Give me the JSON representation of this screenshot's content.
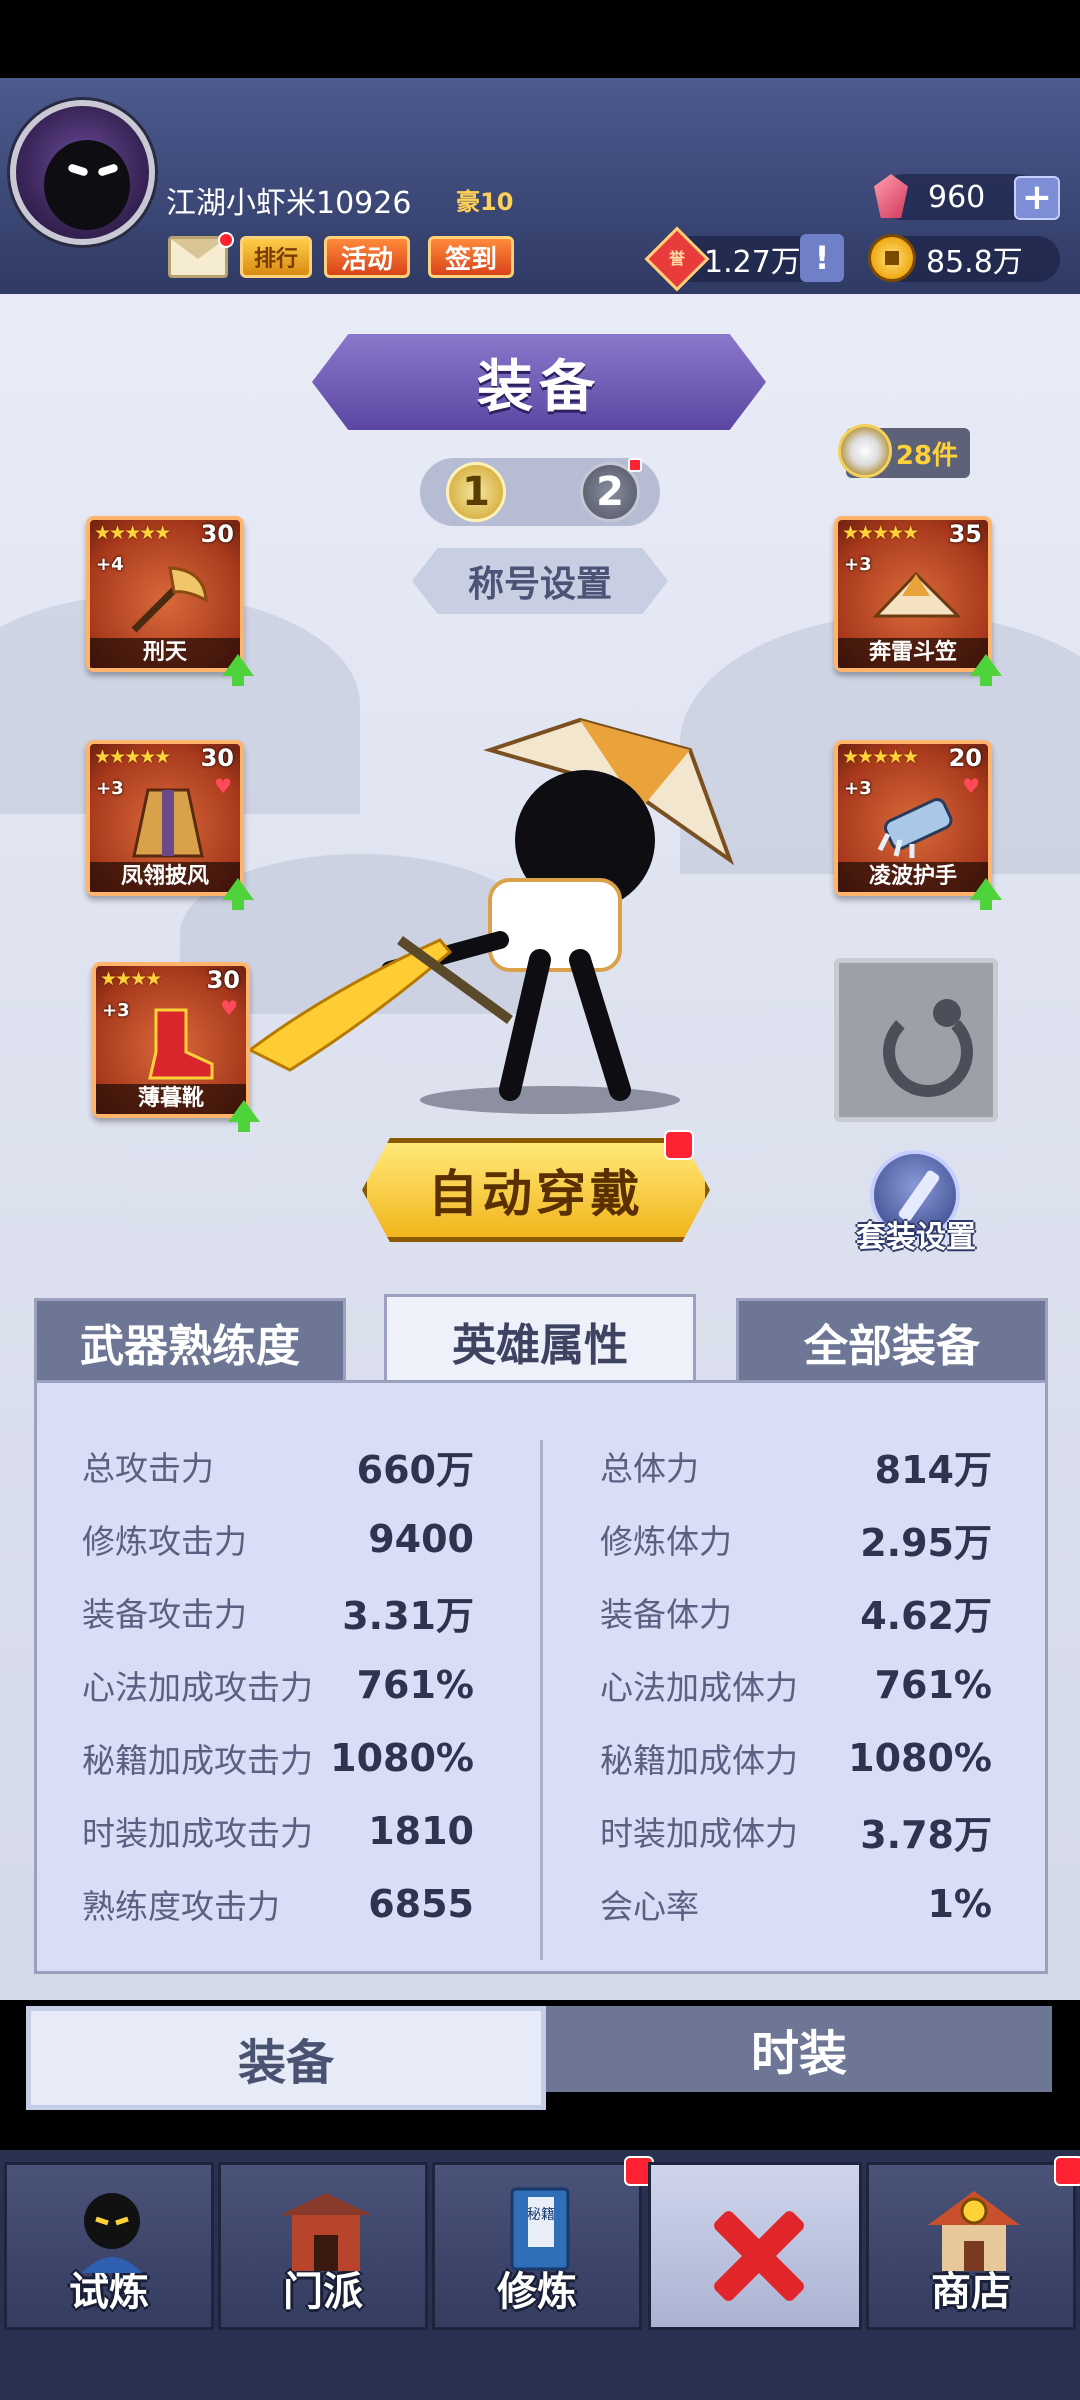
{
  "header": {
    "player_name": "江湖小虾米10926",
    "vip_label": "豪10",
    "buttons": {
      "ranking": "排行",
      "activity": "活动",
      "sign_in": "签到"
    },
    "resources": {
      "gems": "960",
      "honor": "1.27万",
      "coins": "85.8万"
    },
    "honor_icon_text": "誉"
  },
  "page": {
    "title": "装备",
    "presets": [
      "1",
      "2"
    ],
    "title_settings_button": "称号设置",
    "pieces_count": "28件",
    "auto_equip_button": "自动穿戴",
    "set_settings_label": "套装设置"
  },
  "equipment": {
    "weapon": {
      "name": "刑天",
      "stars": "★★★★★",
      "level": "30",
      "plus": "+4"
    },
    "hat": {
      "name": "奔雷斗笠",
      "stars": "★★★★★",
      "level": "35",
      "plus": "+3"
    },
    "cape": {
      "name": "凤翎披风",
      "stars": "★★★★★",
      "level": "30",
      "plus": "+3"
    },
    "gauntlet": {
      "name": "凌波护手",
      "stars": "★★★★★",
      "level": "20",
      "plus": "+3"
    },
    "boots": {
      "name": "薄暮靴",
      "stars": "★★★★",
      "level": "30",
      "plus": "+3"
    }
  },
  "tabs": {
    "mastery": "武器熟练度",
    "attributes": "英雄属性",
    "all_equipment": "全部装备"
  },
  "stats": {
    "left": [
      {
        "label": "总攻击力",
        "value": "660万"
      },
      {
        "label": "修炼攻击力",
        "value": "9400"
      },
      {
        "label": "装备攻击力",
        "value": "3.31万"
      },
      {
        "label": "心法加成攻击力",
        "value": "761%"
      },
      {
        "label": "秘籍加成攻击力",
        "value": "1080%"
      },
      {
        "label": "时装加成攻击力",
        "value": "1810"
      },
      {
        "label": "熟练度攻击力",
        "value": "6855"
      }
    ],
    "right": [
      {
        "label": "总体力",
        "value": "814万"
      },
      {
        "label": "修炼体力",
        "value": "2.95万"
      },
      {
        "label": "装备体力",
        "value": "4.62万"
      },
      {
        "label": "心法加成体力",
        "value": "761%"
      },
      {
        "label": "秘籍加成体力",
        "value": "1080%"
      },
      {
        "label": "时装加成体力",
        "value": "3.78万"
      },
      {
        "label": "会心率",
        "value": "1%"
      }
    ]
  },
  "sub_tabs": {
    "equipment": "装备",
    "fashion": "时装"
  },
  "nav": {
    "trial": "试炼",
    "sect": "门派",
    "cultivate": "修炼",
    "shop": "商店",
    "cultivate_book_text": "秘籍"
  },
  "colors": {
    "header_bg": "#3b4775",
    "accent_purple": "#5b47a2",
    "button_gold": "#f2b51c",
    "notification_red": "#ff2233"
  }
}
